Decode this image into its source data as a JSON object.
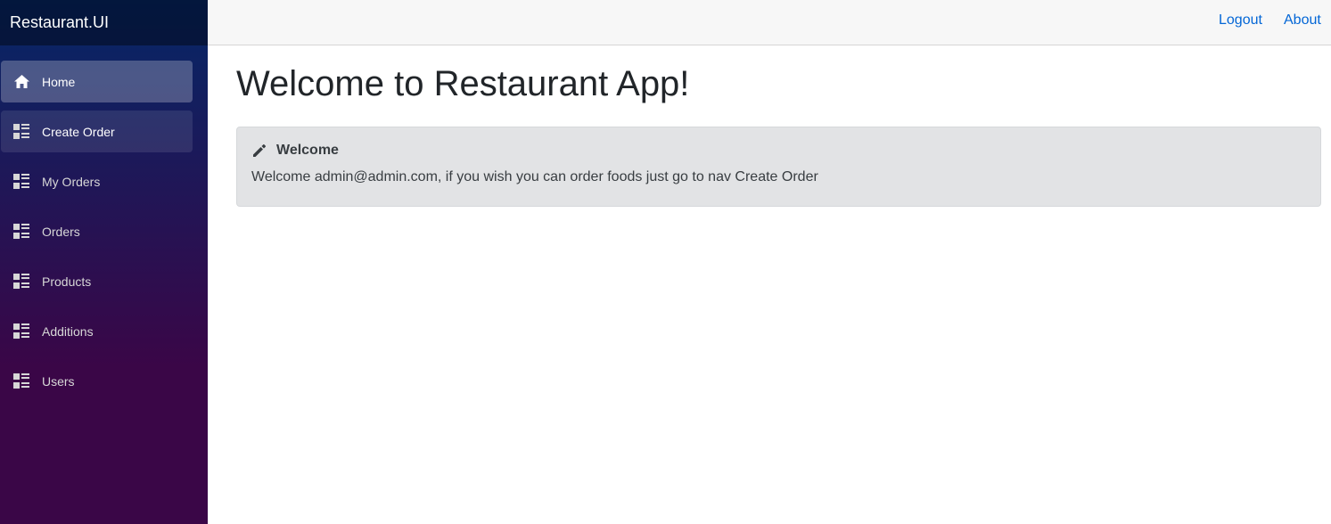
{
  "app": {
    "brand": "Restaurant.UI"
  },
  "sidebar": {
    "items": [
      {
        "label": "Home",
        "icon": "home-icon",
        "state": "active"
      },
      {
        "label": "Create Order",
        "icon": "list-icon",
        "state": "semi"
      },
      {
        "label": "My Orders",
        "icon": "list-icon",
        "state": ""
      },
      {
        "label": "Orders",
        "icon": "list-icon",
        "state": ""
      },
      {
        "label": "Products",
        "icon": "list-icon",
        "state": ""
      },
      {
        "label": "Additions",
        "icon": "list-icon",
        "state": ""
      },
      {
        "label": "Users",
        "icon": "list-icon",
        "state": ""
      }
    ]
  },
  "header": {
    "logout_label": "Logout",
    "about_label": "About"
  },
  "main": {
    "title": "Welcome to Restaurant App!",
    "alert": {
      "heading": "Welcome",
      "icon": "pencil-icon",
      "message": "Welcome admin@admin.com, if you wish you can order foods just go to nav Create Order"
    }
  },
  "colors": {
    "sidebar_top": "#052767",
    "sidebar_bottom": "#3a0647",
    "link": "#0366d6",
    "alert_bg": "#e2e3e5"
  }
}
